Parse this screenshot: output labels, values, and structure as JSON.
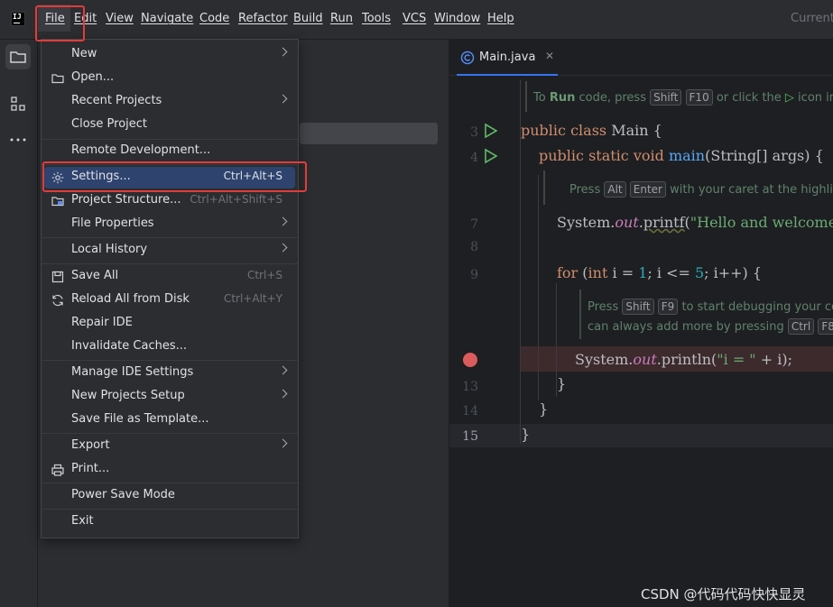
{
  "app": {
    "logo_text": "IJ",
    "current_file_label": "Current"
  },
  "menubar": {
    "items": [
      "File",
      "Edit",
      "View",
      "Navigate",
      "Code",
      "Refactor",
      "Build",
      "Run",
      "Tools",
      "VCS",
      "Window",
      "Help"
    ]
  },
  "file_menu": {
    "items": [
      {
        "label": "New",
        "submenu": true
      },
      {
        "label": "Open...",
        "icon": "folder-icon"
      },
      {
        "label": "Recent Projects",
        "submenu": true
      },
      {
        "label": "Close Project"
      },
      {
        "label": "Remote Development..."
      },
      {
        "label": "Settings...",
        "shortcut": "Ctrl+Alt+S",
        "icon": "gear-icon",
        "active": true
      },
      {
        "label": "Project Structure...",
        "shortcut": "Ctrl+Alt+Shift+S",
        "icon": "project-structure-icon"
      },
      {
        "label": "File Properties",
        "submenu": true
      },
      {
        "label": "Local History",
        "submenu": true
      },
      {
        "label": "Save All",
        "shortcut": "Ctrl+S",
        "icon": "save-icon"
      },
      {
        "label": "Reload All from Disk",
        "shortcut": "Ctrl+Alt+Y",
        "icon": "reload-icon"
      },
      {
        "label": "Repair IDE"
      },
      {
        "label": "Invalidate Caches..."
      },
      {
        "label": "Manage IDE Settings",
        "submenu": true
      },
      {
        "label": "New Projects Setup",
        "submenu": true
      },
      {
        "label": "Save File as Template..."
      },
      {
        "label": "Export",
        "submenu": true
      },
      {
        "label": "Print...",
        "icon": "print-icon"
      },
      {
        "label": "Power Save Mode"
      },
      {
        "label": "Exit"
      }
    ]
  },
  "editor": {
    "tab_label": "Main.java",
    "line_numbers": [
      "3",
      "4",
      "7",
      "8",
      "9",
      "13",
      "14",
      "15"
    ],
    "hint1": {
      "pre": "To ",
      "bold": "Run",
      "mid": " code, press ",
      "k1": "Shift",
      "k2": "F10",
      "post": " or click the ",
      "post2": " icon in"
    },
    "hint2": {
      "pre": "Press ",
      "k1": "Alt",
      "k2": "Enter",
      "post": " with your caret at the highlig"
    },
    "hint3": {
      "pre": "Press ",
      "k1": "Shift",
      "k2": "F9",
      "post": " to start debugging your co"
    },
    "hint4": {
      "pre": "can always add more by pressing ",
      "k1": "Ctrl",
      "k2": "F8",
      "post": "."
    },
    "code": {
      "l3_kw": "public class ",
      "l3_name": "Main ",
      "l3_brace": "{",
      "l4_kw": "public static void ",
      "l4_fn": "main",
      "l4_rest": "(String[] args) {",
      "l7_a": "System.",
      "l7_fld": "out",
      "l7_b": ".",
      "l7_fn": "printf",
      "l7_c": "(",
      "l7_str": "\"Hello and welcome!",
      "l9_kw": "for ",
      "l9_a": "(",
      "l9_kw2": "int ",
      "l9_b": "i = ",
      "l9_n1": "1",
      "l9_c": "; i <= ",
      "l9_n2": "5",
      "l9_d": "; i++) {",
      "l12_a": "System.",
      "l12_fld": "out",
      "l12_b": ".println(",
      "l12_str": "\"i = \"",
      "l12_c": " + i);",
      "l13": "}",
      "l14": "}",
      "l15": "}"
    }
  },
  "watermark": "CSDN @代码代码快快显灵",
  "colors": {
    "highlight": "#e33b3b",
    "active_item": "#2e436e",
    "accent": "#3574f0"
  }
}
